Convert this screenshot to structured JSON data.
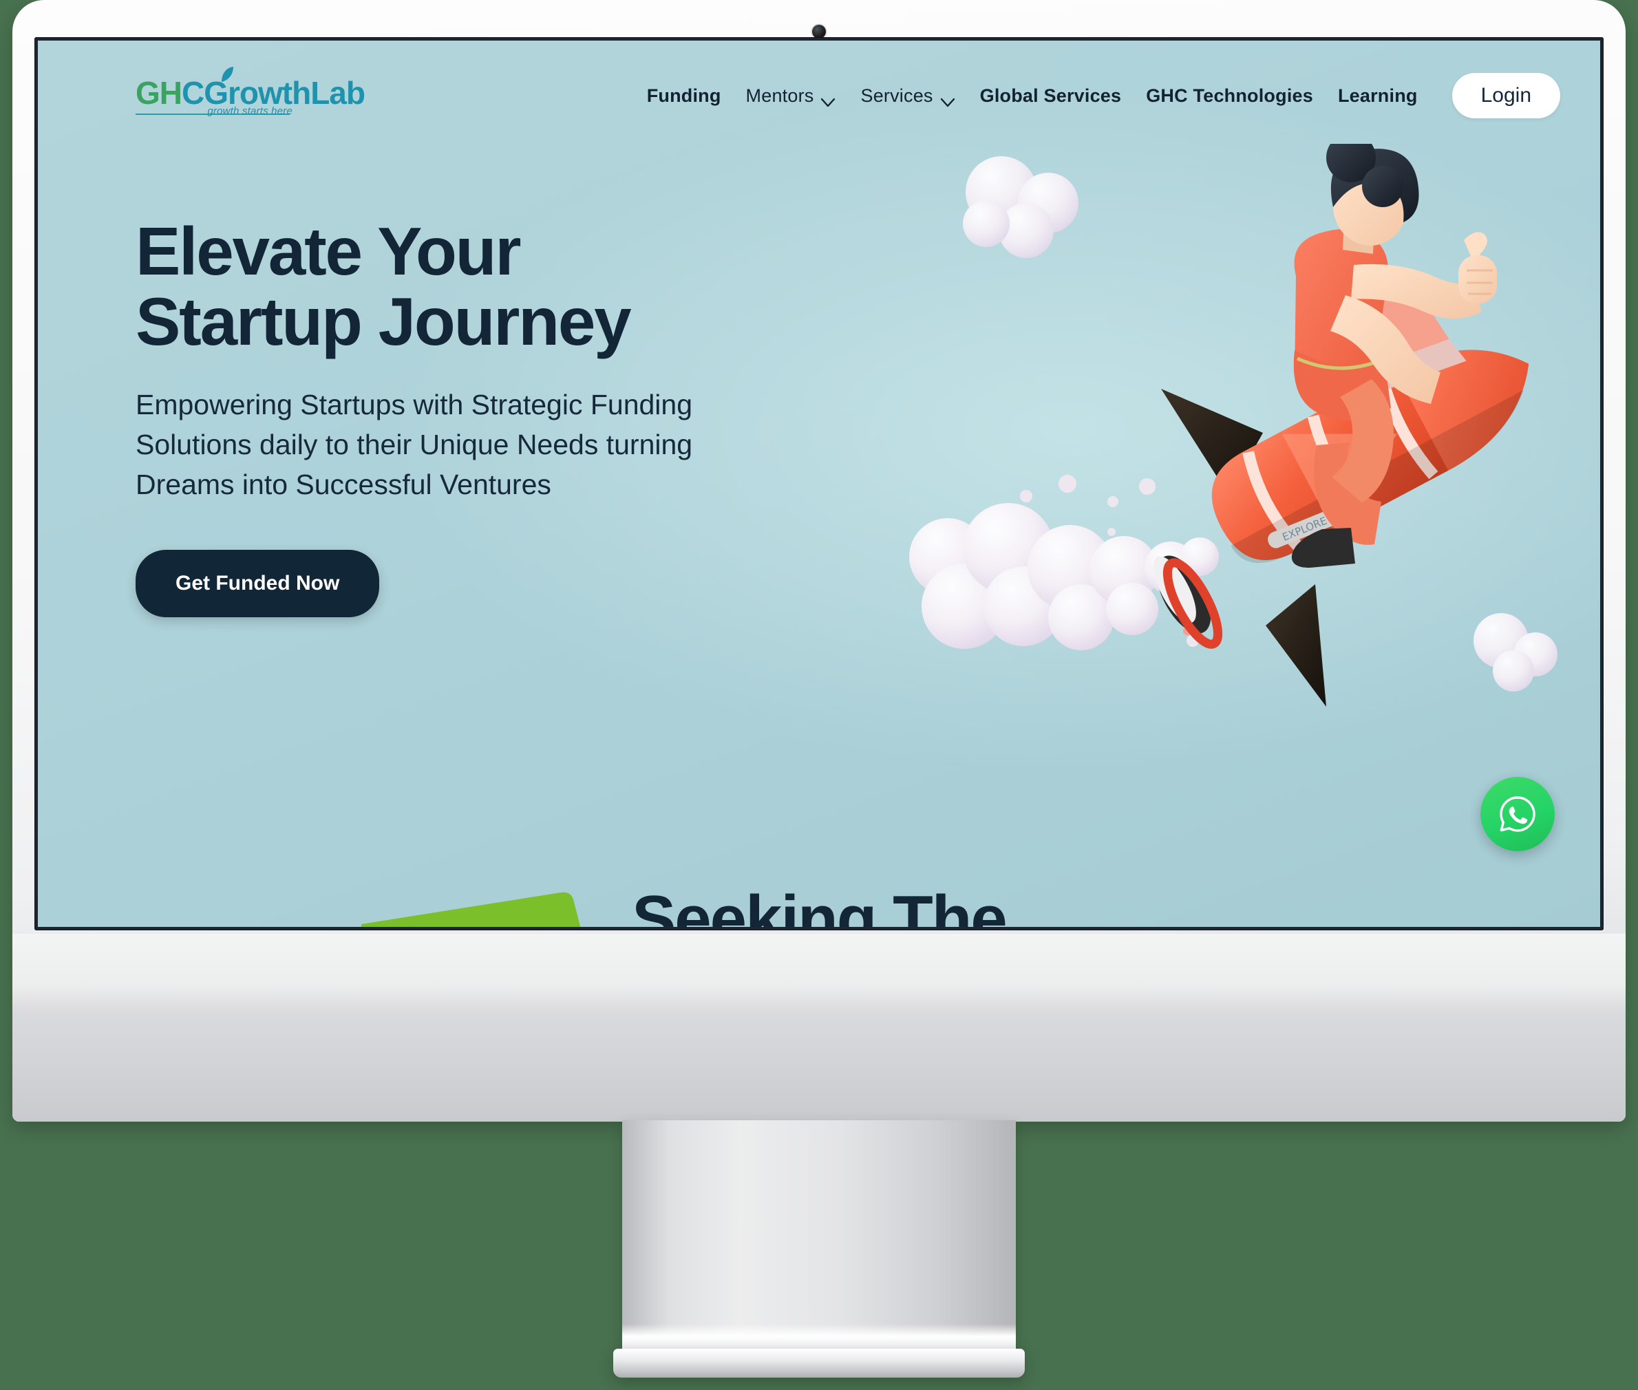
{
  "device": {
    "type": "desktop-monitor",
    "camera_label": "webcam",
    "background_color": "#48714f",
    "bezel_color": "#f7f7f8",
    "stand_color": "#d9dadd"
  },
  "page": {
    "screen_bg_color": "#aed2d9"
  },
  "logo": {
    "part1": "GH",
    "part2": "C",
    "part3": "GrowthLab",
    "tagline": "growth starts here",
    "color_green": "#3aa35f",
    "color_teal": "#1f93ad"
  },
  "nav": {
    "items": [
      {
        "label": "Funding",
        "has_caret": false,
        "bold": true
      },
      {
        "label": "Mentors",
        "has_caret": true,
        "bold": false
      },
      {
        "label": "Services",
        "has_caret": true,
        "bold": false
      },
      {
        "label": "Global Services",
        "has_caret": false,
        "bold": true
      },
      {
        "label": "GHC Technologies",
        "has_caret": false,
        "bold": true
      },
      {
        "label": "Learning",
        "has_caret": false,
        "bold": true
      }
    ],
    "login_label": "Login"
  },
  "hero": {
    "heading_line1": "Elevate Your",
    "heading_line2": "Startup Journey",
    "subtitle": "Empowering Startups with Strategic Funding Solutions daily to their Unique Needs turning Dreams into Successful Ventures",
    "cta_label": "Get Funded Now",
    "heading_color": "#122638",
    "cta_bg_color": "#112636"
  },
  "illustration": {
    "name": "person-riding-rocket",
    "description": "3D render of a person in orange outfit riding an orange rocket with white straps, giving a thumbs up, surrounded by white and lavender clouds",
    "rocket_color": "#ef5535",
    "cloud_color": "#f4eef6"
  },
  "next_section": {
    "heading": "Seeking The",
    "green_card_color": "#7bc02a"
  },
  "floating": {
    "whatsapp_label": "whatsapp-chat",
    "whatsapp_color": "#25d366"
  }
}
